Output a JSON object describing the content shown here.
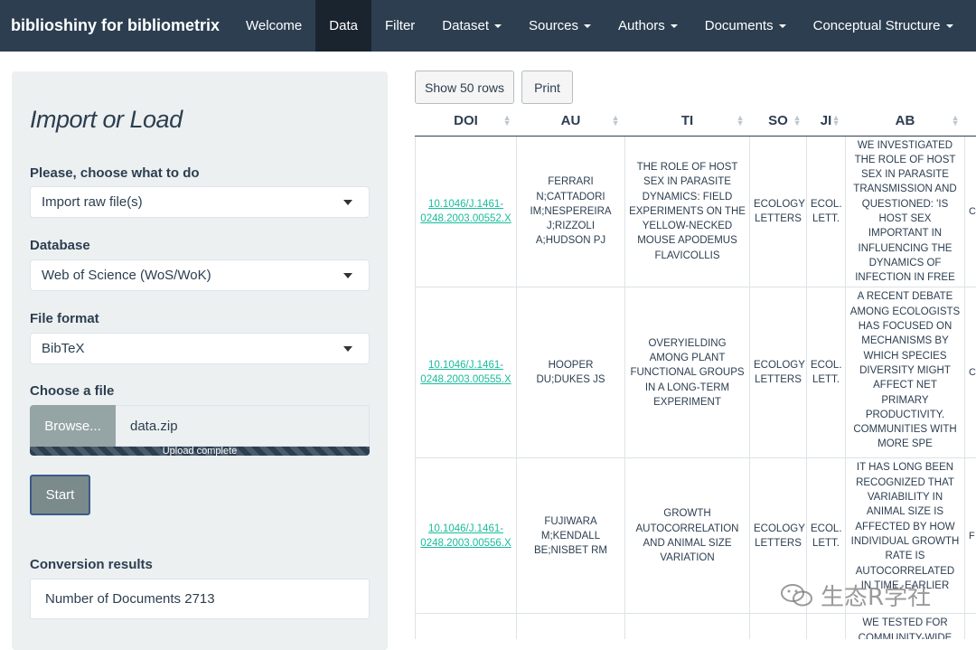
{
  "navbar": {
    "brand": "biblioshiny for bibliometrix",
    "items": [
      {
        "label": "Welcome",
        "dropdown": false
      },
      {
        "label": "Data",
        "dropdown": false,
        "active": true
      },
      {
        "label": "Filter",
        "dropdown": false
      },
      {
        "label": "Dataset",
        "dropdown": true
      },
      {
        "label": "Sources",
        "dropdown": true
      },
      {
        "label": "Authors",
        "dropdown": true
      },
      {
        "label": "Documents",
        "dropdown": true
      },
      {
        "label": "Conceptual Structure",
        "dropdown": true
      }
    ]
  },
  "sidebar": {
    "title": "Import or Load",
    "action_label": "Please, choose what to do",
    "action_value": "Import raw file(s)",
    "database_label": "Database",
    "database_value": "Web of Science (WoS/WoK)",
    "format_label": "File format",
    "format_value": "BibTeX",
    "file_label": "Choose a file",
    "browse_label": "Browse...",
    "file_name": "data.zip",
    "upload_status": "Upload complete",
    "start_label": "Start",
    "results_label": "Conversion results",
    "results_value": "Number of Documents  2713"
  },
  "main": {
    "show_rows_label": "Show 50 rows",
    "print_label": "Print",
    "columns": [
      "DOI",
      "AU",
      "TI",
      "SO",
      "JI",
      "AB"
    ],
    "rows": [
      {
        "doi": "10.1046/J.1461-0248.2003.00552.X",
        "au": "FERRARI N;CATTADORI IM;NESPEREIRA J;RIZZOLI A;HUDSON PJ",
        "ti": "THE ROLE OF HOST SEX IN PARASITE DYNAMICS: FIELD EXPERIMENTS ON THE YELLOW-NECKED MOUSE APODEMUS FLAVICOLLIS",
        "so": "ECOLOGY LETTERS",
        "ji": "ECOL. LETT.",
        "ab": "WE INVESTIGATED THE ROLE OF HOST SEX IN PARASITE TRANSMISSION AND QUESTIONED: 'IS HOST SEX IMPORTANT IN INFLUENCING THE DYNAMICS OF INFECTION IN FREE",
        "extra": "C"
      },
      {
        "doi": "10.1046/J.1461-0248.2003.00555.X",
        "au": "HOOPER DU;DUKES JS",
        "ti": "OVERYIELDING AMONG PLANT FUNCTIONAL GROUPS IN A LONG-TERM EXPERIMENT",
        "so": "ECOLOGY LETTERS",
        "ji": "ECOL. LETT.",
        "ab": "A RECENT DEBATE AMONG ECOLOGISTS HAS FOCUSED ON MECHANISMS BY WHICH SPECIES DIVERSITY MIGHT AFFECT NET PRIMARY PRODUCTIVITY. COMMUNITIES WITH MORE SPE",
        "extra": "C"
      },
      {
        "doi": "10.1046/J.1461-0248.2003.00556.X",
        "au": "FUJIWARA M;KENDALL BE;NISBET RM",
        "ti": "GROWTH AUTOCORRELATION AND ANIMAL SIZE VARIATION",
        "so": "ECOLOGY LETTERS",
        "ji": "ECOL. LETT.",
        "ab": "IT HAS LONG BEEN RECOGNIZED THAT VARIABILITY IN ANIMAL SIZE IS AFFECTED BY HOW INDIVIDUAL GROWTH RATE IS AUTOCORRELATED IN TIME. EARLIER",
        "extra": "F"
      },
      {
        "doi": "",
        "au": "",
        "ti": "",
        "so": "",
        "ji": "",
        "ab": "WE TESTED FOR COMMUNITY-WIDE",
        "extra": ""
      }
    ]
  },
  "watermark": "生态R学社"
}
